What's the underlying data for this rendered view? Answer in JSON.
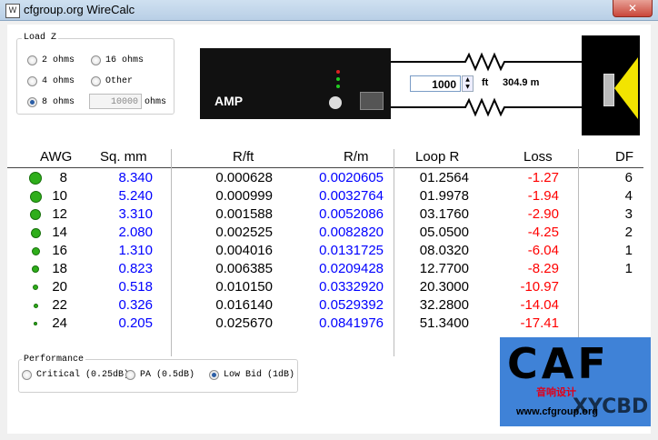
{
  "window": {
    "title": "cfgroup.org WireCalc",
    "close_label": "✕"
  },
  "load_z": {
    "label": "Load Z",
    "options": [
      "2 ohms",
      "16 ohms",
      "4 ohms",
      "Other",
      "8 ohms"
    ],
    "selected": "8 ohms",
    "other_value": "10000",
    "other_unit": "ohms"
  },
  "diagram": {
    "amp_label": "AMP",
    "length_value": "1000",
    "length_unit": "ft",
    "length_meters": "304.9 m"
  },
  "table": {
    "headers": [
      "AWG",
      "Sq. mm",
      "R/ft",
      "R/m",
      "Loop R",
      "Loss",
      "DF"
    ],
    "rows": [
      {
        "awg": "8",
        "sqmm": "8.340",
        "rft": "0.000628",
        "rm": "0.0020605",
        "loop": "01.2564",
        "loss": "-1.27",
        "df": "6"
      },
      {
        "awg": "10",
        "sqmm": "5.240",
        "rft": "0.000999",
        "rm": "0.0032764",
        "loop": "01.9978",
        "loss": "-1.94",
        "df": "4"
      },
      {
        "awg": "12",
        "sqmm": "3.310",
        "rft": "0.001588",
        "rm": "0.0052086",
        "loop": "03.1760",
        "loss": "-2.90",
        "df": "3"
      },
      {
        "awg": "14",
        "sqmm": "2.080",
        "rft": "0.002525",
        "rm": "0.0082820",
        "loop": "05.0500",
        "loss": "-4.25",
        "df": "2"
      },
      {
        "awg": "16",
        "sqmm": "1.310",
        "rft": "0.004016",
        "rm": "0.0131725",
        "loop": "08.0320",
        "loss": "-6.04",
        "df": "1"
      },
      {
        "awg": "18",
        "sqmm": "0.823",
        "rft": "0.006385",
        "rm": "0.0209428",
        "loop": "12.7700",
        "loss": "-8.29",
        "df": "1"
      },
      {
        "awg": "20",
        "sqmm": "0.518",
        "rft": "0.010150",
        "rm": "0.0332920",
        "loop": "20.3000",
        "loss": "-10.97",
        "df": ""
      },
      {
        "awg": "22",
        "sqmm": "0.326",
        "rft": "0.016140",
        "rm": "0.0529392",
        "loop": "32.2800",
        "loss": "-14.04",
        "df": ""
      },
      {
        "awg": "24",
        "sqmm": "0.205",
        "rft": "0.025670",
        "rm": "0.0841976",
        "loop": "51.3400",
        "loss": "-17.41",
        "df": ""
      }
    ]
  },
  "performance": {
    "label": "Performance",
    "options": [
      "Critical (0.25dB)",
      "PA (0.5dB)",
      "Low Bid (1dB)"
    ],
    "selected": "Low Bid (1dB)"
  },
  "logo": {
    "letters": "CAF",
    "chinese": "音响设计",
    "url": "www.cfgroup.org",
    "watermark": "XYCBD"
  },
  "colors": {
    "blue_values": "#0000ff",
    "loss_red": "#ff0000",
    "indicator_green": "#2eae1a",
    "logo_bg": "#3f82d7",
    "speaker_cone": "#f2e400"
  }
}
